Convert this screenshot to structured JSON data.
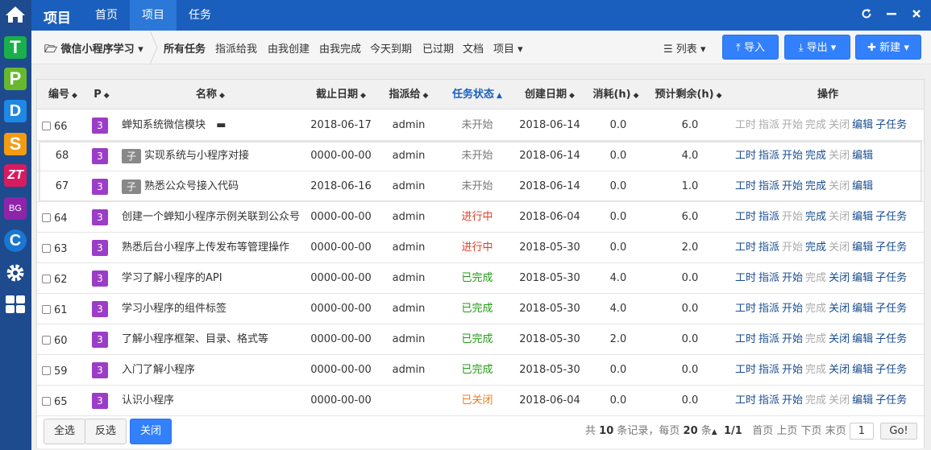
{
  "top": {
    "app_title": "项目",
    "tabs": [
      {
        "label": "首页",
        "active": false
      },
      {
        "label": "项目",
        "active": true
      },
      {
        "label": "任务",
        "active": false
      }
    ]
  },
  "dock": {
    "items": [
      {
        "label": "",
        "icon": "home-icon"
      },
      {
        "label": "T",
        "icon": "t-app-icon"
      },
      {
        "label": "P",
        "icon": "p-app-icon"
      },
      {
        "label": "D",
        "icon": "d-app-icon"
      },
      {
        "label": "S",
        "icon": "s-app-icon"
      },
      {
        "label": "ZT",
        "icon": "zt-app-icon"
      },
      {
        "label": "BG",
        "icon": "bg-app-icon"
      },
      {
        "label": "C",
        "icon": "c-app-icon"
      },
      {
        "label": "",
        "icon": "gear-icon"
      },
      {
        "label": "",
        "icon": "grid-icon"
      }
    ]
  },
  "subnav": {
    "project": "微信小程序学习",
    "filters": [
      "所有任务",
      "指派给我",
      "由我创建",
      "由我完成",
      "今天到期",
      "已过期",
      "文档",
      "项目"
    ],
    "view": "列表",
    "import": "导入",
    "export": "导出",
    "create": "新建"
  },
  "table": {
    "headers": {
      "id": "编号",
      "pri": "P",
      "name": "名称",
      "deadline": "截止日期",
      "assigned": "指派给",
      "status": "任务状态",
      "created": "创建日期",
      "consumed": "消耗(h)",
      "left": "预计剩余(h)",
      "actions": "操作"
    },
    "rows": [
      {
        "id": "66",
        "pri": "3",
        "name": "蝉知系统微信模块",
        "deadline": "2018-06-17",
        "assigned": "admin",
        "status": "未开始",
        "status_class": "st-new",
        "created": "2018-06-14",
        "consumed": "0.0",
        "left": "6.0",
        "child": false
      },
      {
        "id": "68",
        "pri": "3",
        "sub": "子",
        "name": "实现系统与小程序对接",
        "deadline": "0000-00-00",
        "assigned": "admin",
        "status": "未开始",
        "status_class": "st-new",
        "created": "2018-06-14",
        "consumed": "0.0",
        "left": "4.0",
        "child": true
      },
      {
        "id": "67",
        "pri": "3",
        "sub": "子",
        "name": "熟悉公众号接入代码",
        "deadline": "2018-06-16",
        "assigned": "admin",
        "status": "未开始",
        "status_class": "st-new",
        "created": "2018-06-14",
        "consumed": "0.0",
        "left": "1.0",
        "child": true
      },
      {
        "id": "64",
        "pri": "3",
        "name": "创建一个蝉知小程序示例关联到公众号",
        "deadline": "0000-00-00",
        "assigned": "admin",
        "status": "进行中",
        "status_class": "st-doing",
        "created": "2018-06-04",
        "consumed": "0.0",
        "left": "6.0",
        "child": false
      },
      {
        "id": "63",
        "pri": "3",
        "name": "熟悉后台小程序上传发布等管理操作",
        "deadline": "0000-00-00",
        "assigned": "admin",
        "status": "进行中",
        "status_class": "st-doing",
        "created": "2018-05-30",
        "consumed": "0.0",
        "left": "2.0",
        "child": false
      },
      {
        "id": "62",
        "pri": "3",
        "name": "学习了解小程序的API",
        "deadline": "0000-00-00",
        "assigned": "admin",
        "status": "已完成",
        "status_class": "st-done",
        "created": "2018-05-30",
        "consumed": "4.0",
        "left": "0.0",
        "child": false
      },
      {
        "id": "61",
        "pri": "3",
        "name": "学习小程序的组件标签",
        "deadline": "0000-00-00",
        "assigned": "admin",
        "status": "已完成",
        "status_class": "st-done",
        "created": "2018-05-30",
        "consumed": "4.0",
        "left": "0.0",
        "child": false
      },
      {
        "id": "60",
        "pri": "3",
        "name": "了解小程序框架、目录、格式等",
        "deadline": "0000-00-00",
        "assigned": "admin",
        "status": "已完成",
        "status_class": "st-done",
        "created": "2018-05-30",
        "consumed": "2.0",
        "left": "0.0",
        "child": false
      },
      {
        "id": "59",
        "pri": "3",
        "name": "入门了解小程序",
        "deadline": "0000-00-00",
        "assigned": "admin",
        "status": "已完成",
        "status_class": "st-done",
        "created": "2018-05-30",
        "consumed": "0.0",
        "left": "0.0",
        "child": false
      },
      {
        "id": "65",
        "pri": "3",
        "name": "认识小程序",
        "deadline": "0000-00-00",
        "assigned": "",
        "status": "已关闭",
        "status_class": "st-closed",
        "created": "2018-06-04",
        "consumed": "0.0",
        "left": "0.0",
        "child": false
      }
    ],
    "actions": [
      [
        "工时",
        "指派",
        "开始",
        "完成",
        "关闭",
        "编辑",
        "子任务"
      ],
      [
        "工时",
        "指派",
        "开始",
        "完成",
        "关闭",
        "编辑"
      ],
      [
        "工时",
        "指派",
        "开始",
        "完成",
        "关闭",
        "编辑"
      ],
      [
        "工时",
        "指派",
        "开始",
        "完成",
        "关闭",
        "编辑",
        "子任务"
      ],
      [
        "工时",
        "指派",
        "开始",
        "完成",
        "关闭",
        "编辑",
        "子任务"
      ],
      [
        "工时",
        "指派",
        "开始",
        "完成",
        "关闭",
        "编辑",
        "子任务"
      ],
      [
        "工时",
        "指派",
        "开始",
        "完成",
        "关闭",
        "编辑",
        "子任务"
      ],
      [
        "工时",
        "指派",
        "开始",
        "完成",
        "关闭",
        "编辑",
        "子任务"
      ],
      [
        "工时",
        "指派",
        "开始",
        "完成",
        "关闭",
        "编辑",
        "子任务"
      ],
      [
        "工时",
        "指派",
        "开始",
        "完成",
        "关闭",
        "编辑",
        "子任务"
      ]
    ],
    "action_enabled": [
      [
        false,
        false,
        false,
        false,
        false,
        true,
        true
      ],
      [
        true,
        true,
        true,
        true,
        false,
        true
      ],
      [
        true,
        true,
        true,
        true,
        false,
        true
      ],
      [
        true,
        true,
        false,
        true,
        false,
        true,
        true
      ],
      [
        true,
        true,
        false,
        true,
        false,
        true,
        true
      ],
      [
        true,
        true,
        true,
        false,
        true,
        true,
        true
      ],
      [
        true,
        true,
        true,
        false,
        true,
        true,
        true
      ],
      [
        true,
        true,
        true,
        false,
        true,
        true,
        true
      ],
      [
        true,
        true,
        true,
        false,
        true,
        true,
        true
      ],
      [
        true,
        true,
        true,
        false,
        false,
        true,
        true
      ]
    ]
  },
  "footer": {
    "select_all": "全选",
    "invert": "反选",
    "close": "关闭",
    "pager_prefix": "共",
    "total": "10",
    "pager_records": "条记录，每页",
    "per_page": "20",
    "pager_suffix": "条",
    "page_info": "1/1",
    "first": "首页",
    "prev": "上页",
    "next": "下页",
    "last": "末页",
    "page_value": "1",
    "go": "Go!"
  }
}
